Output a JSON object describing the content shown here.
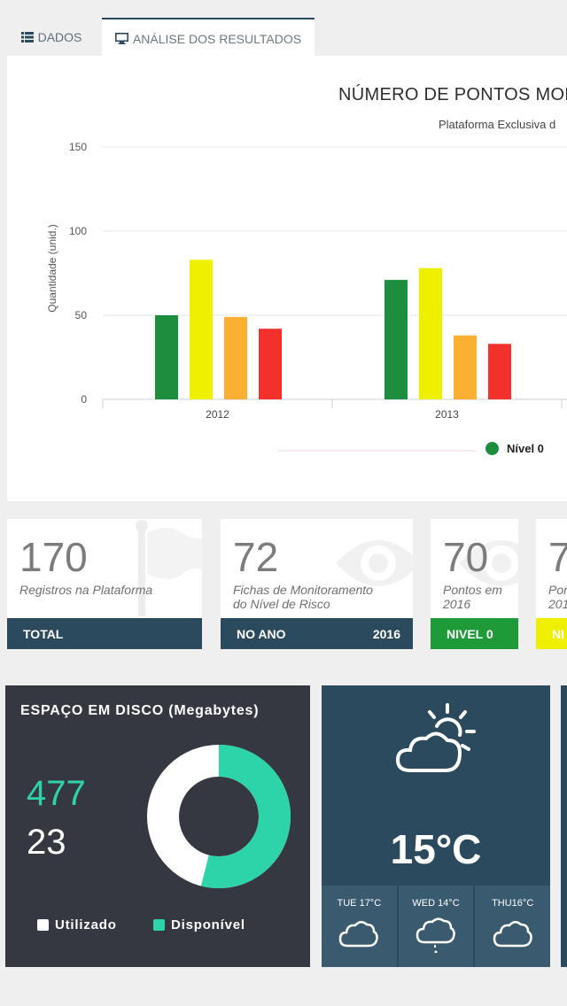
{
  "tabs": [
    {
      "label": "DADOS",
      "icon": "list-icon"
    },
    {
      "label": "ANÁLISE DOS RESULTADOS",
      "icon": "monitor-icon"
    }
  ],
  "chart_data": {
    "type": "bar",
    "title": "NÚMERO DE PONTOS MON",
    "subtitle": "Plataforma Exclusiva d",
    "ylabel": "Quantidade (unid.)",
    "ylim": [
      0,
      150
    ],
    "yticks": [
      "0",
      "50",
      "100",
      "150"
    ],
    "categories": [
      "2012",
      "2013"
    ],
    "series": [
      {
        "name": "Nível 0",
        "color": "#1e8e3e",
        "values": [
          50,
          71
        ]
      },
      {
        "color": "#eef000",
        "values": [
          83,
          78
        ]
      },
      {
        "color": "#fbb034",
        "values": [
          49,
          38
        ]
      },
      {
        "color": "#f2302c",
        "values": [
          42,
          33
        ]
      }
    ],
    "grid": true,
    "legend": "bottom-right"
  },
  "stats": [
    {
      "value": "170",
      "desc": [
        "Registros na Plataforma"
      ],
      "bar_label": "TOTAL",
      "bar_right": "",
      "color": "#2c4a5e",
      "icon": "flag-icon"
    },
    {
      "value": "72",
      "desc": [
        "Fichas de Monitoramento",
        "do Nível de Risco"
      ],
      "bar_label": "NO ANO",
      "bar_right": "2016",
      "color": "#2c4a5e",
      "icon": "eye-icon"
    },
    {
      "value": "70",
      "desc": [
        "Pontos em",
        "2016"
      ],
      "bar_label": "NIVEL 0",
      "bar_right": "",
      "color": "#1e9a38",
      "icon": "eye-icon"
    },
    {
      "value": "7",
      "desc": [
        "Pon",
        "201"
      ],
      "bar_label": "NI",
      "bar_right": "",
      "color": "#eef000"
    }
  ],
  "disk": {
    "title": "ESPAÇO EM DISCO (Megabytes)",
    "value_available": "477",
    "value_used": "23",
    "used_label": "Utilizado",
    "available_label": "Disponível",
    "used_color": "#ffffff",
    "available_color": "#2ed4a9",
    "available_fraction": 0.54
  },
  "weather": {
    "temp": "15°C",
    "icon": "partly-cloudy-icon",
    "days": [
      {
        "label": "TUE 17°C",
        "icon": "cloud-icon"
      },
      {
        "label": "WED 14°C",
        "icon": "rain-cloud-icon"
      },
      {
        "label": "THU16°C",
        "icon": "cloud-icon"
      }
    ]
  }
}
